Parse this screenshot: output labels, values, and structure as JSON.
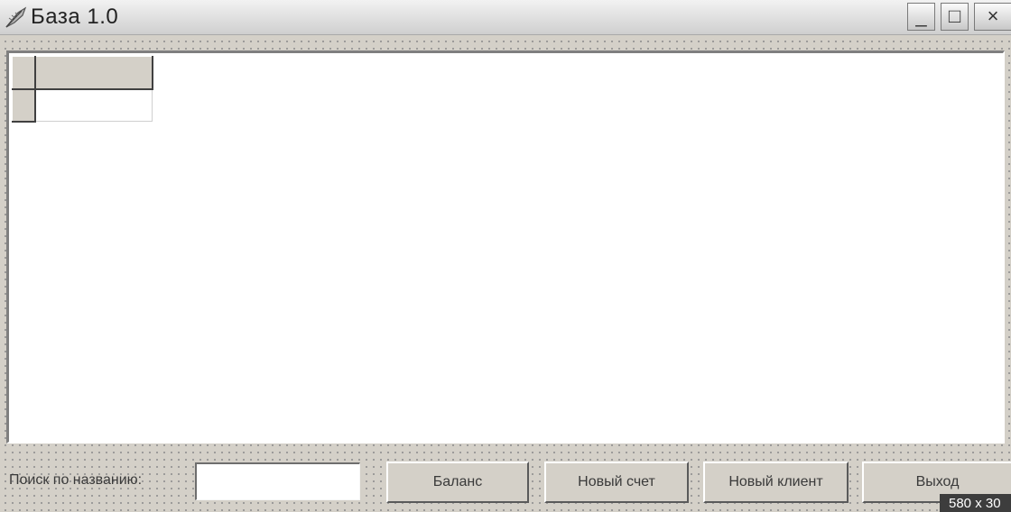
{
  "window": {
    "title": "База 1.0",
    "minimize_glyph": "_",
    "maximize_glyph": "□",
    "close_glyph": "×",
    "icon": "app-feather-icon"
  },
  "grid": {
    "columns": [
      ""
    ],
    "rows": [
      [
        ""
      ]
    ]
  },
  "search": {
    "label": "Поиск по названию:",
    "value": ""
  },
  "buttons": {
    "balance": "Баланс",
    "new_account": "Новый счет",
    "new_client": "Новый клиент",
    "exit": "Выход"
  },
  "size_badge": "580 x 30"
}
